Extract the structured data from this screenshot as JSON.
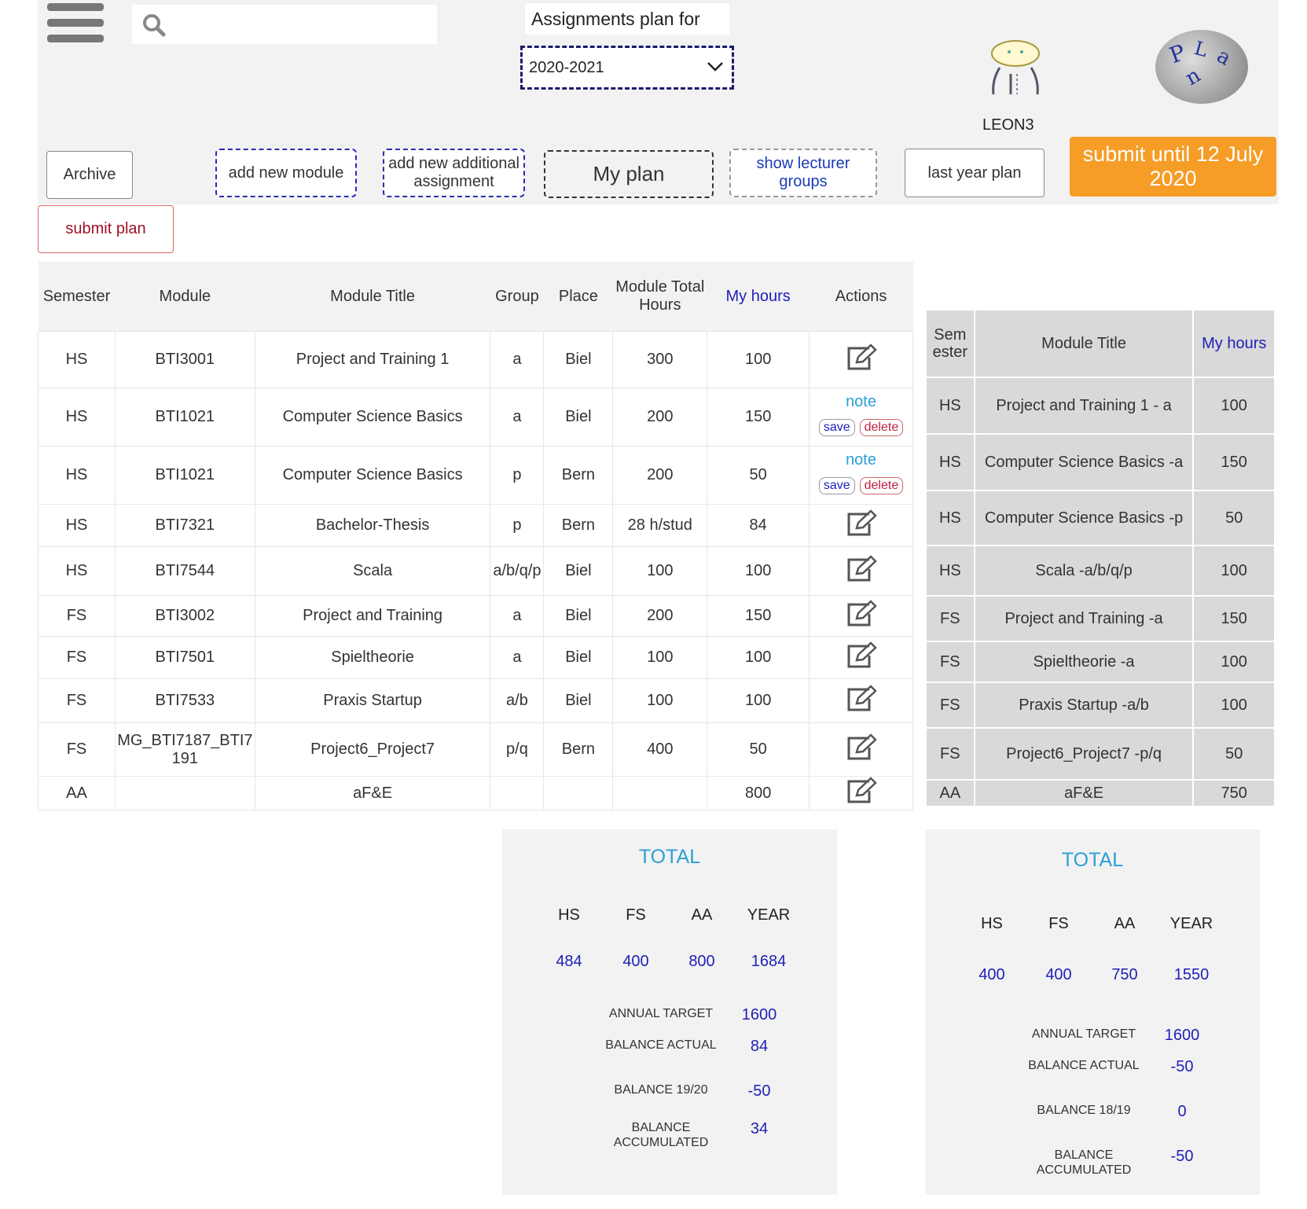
{
  "header": {
    "title": "Assignments plan for",
    "year": "2020-2021",
    "user": "LEON3",
    "search_placeholder": ""
  },
  "buttons": {
    "archive": "Archive",
    "add_module": "add new module",
    "add_additional": "add new additional assignment",
    "my_plan": "My plan",
    "lecturer_groups": "show lecturer groups",
    "last_year": "last year plan",
    "submit_until": "submit until 12 July 2020",
    "submit_plan": "submit plan"
  },
  "main_table": {
    "headers": [
      "Semester",
      "Module",
      "Module Title",
      "Group",
      "Place",
      "Module Total Hours",
      "My hours",
      "Actions"
    ],
    "note_label": "note",
    "save_label": "save",
    "delete_label": "delete",
    "rows": [
      {
        "semester": "HS",
        "module": "BTI3001",
        "title": "Project and Training 1",
        "group": "a",
        "place": "Biel",
        "total": "300",
        "hours": "100",
        "action": "edit"
      },
      {
        "semester": "HS",
        "module": "BTI1021",
        "title": "Computer Science Basics",
        "group": "a",
        "place": "Biel",
        "total": "200",
        "hours": "150",
        "action": "note"
      },
      {
        "semester": "HS",
        "module": "BTI1021",
        "title": "Computer Science Basics",
        "group": "p",
        "place": "Bern",
        "total": "200",
        "hours": "50",
        "action": "note"
      },
      {
        "semester": "HS",
        "module": "BTI7321",
        "title": "Bachelor-Thesis",
        "group": "p",
        "place": "Bern",
        "total": "28 h/stud",
        "hours": "84",
        "action": "edit"
      },
      {
        "semester": "HS",
        "module": "BTI7544",
        "title": "Scala",
        "group": "a/b/q/p",
        "place": "Biel",
        "total": "100",
        "hours": "100",
        "action": "edit"
      },
      {
        "semester": "FS",
        "module": "BTI3002",
        "title": "Project and Training",
        "group": "a",
        "place": "Biel",
        "total": "200",
        "hours": "150",
        "action": "edit"
      },
      {
        "semester": "FS",
        "module": "BTI7501",
        "title": "Spieltheorie",
        "group": "a",
        "place": "Biel",
        "total": "100",
        "hours": "100",
        "action": "edit"
      },
      {
        "semester": "FS",
        "module": "BTI7533",
        "title": "Praxis Startup",
        "group": "a/b",
        "place": "Biel",
        "total": "100",
        "hours": "100",
        "action": "edit"
      },
      {
        "semester": "FS",
        "module": "MG_BTI7187_BTI7191",
        "title": "Project6_Project7",
        "group": "p/q",
        "place": "Bern",
        "total": "400",
        "hours": "50",
        "action": "edit"
      },
      {
        "semester": "AA",
        "module": "",
        "title": "aF&E",
        "group": "",
        "place": "",
        "total": "",
        "hours": "800",
        "action": "edit"
      }
    ]
  },
  "side_table": {
    "headers": [
      "Semester",
      "Module Title",
      "My hours"
    ],
    "rows": [
      {
        "semester": "HS",
        "title": "Project and Training 1 - a",
        "hours": "100"
      },
      {
        "semester": "HS",
        "title": "Computer Science Basics -a",
        "hours": "150"
      },
      {
        "semester": "HS",
        "title": "Computer Science Basics -p",
        "hours": "50"
      },
      {
        "semester": "HS",
        "title": "Scala -a/b/q/p",
        "hours": "100"
      },
      {
        "semester": "FS",
        "title": "Project and Training -a",
        "hours": "150"
      },
      {
        "semester": "FS",
        "title": "Spieltheorie -a",
        "hours": "100"
      },
      {
        "semester": "FS",
        "title": "Praxis Startup -a/b",
        "hours": "100"
      },
      {
        "semester": "FS",
        "title": "Project6_Project7 -p/q",
        "hours": "50"
      },
      {
        "semester": "AA",
        "title": "aF&E",
        "hours": "750"
      }
    ]
  },
  "totals_current": {
    "title": "TOTAL",
    "labels": [
      "HS",
      "FS",
      "AA",
      "YEAR"
    ],
    "values": [
      "484",
      "400",
      "800",
      "1684"
    ],
    "annual_target_label": "ANNUAL TARGET",
    "annual_target": "1600",
    "balance_actual_label": "BALANCE ACTUAL",
    "balance_actual": "84",
    "balance_prev_label": "BALANCE 19/20",
    "balance_prev": "-50",
    "balance_acc_label": "BALANCE ACCUMULATED",
    "balance_acc": "34"
  },
  "totals_last": {
    "title": "TOTAL",
    "labels": [
      "HS",
      "FS",
      "AA",
      "YEAR"
    ],
    "values": [
      "400",
      "400",
      "750",
      "1550"
    ],
    "annual_target_label": "ANNUAL TARGET",
    "annual_target": "1600",
    "balance_actual_label": "BALANCE ACTUAL",
    "balance_actual": "-50",
    "balance_prev_label": "BALANCE 18/19",
    "balance_prev": "0",
    "balance_acc_label": "BALANCE ACCUMULATED",
    "balance_acc": "-50"
  },
  "colors": {
    "accent": "#f59d27",
    "link_blue": "#2020b8",
    "note_blue": "#2a9fd6",
    "danger": "#a01025"
  }
}
